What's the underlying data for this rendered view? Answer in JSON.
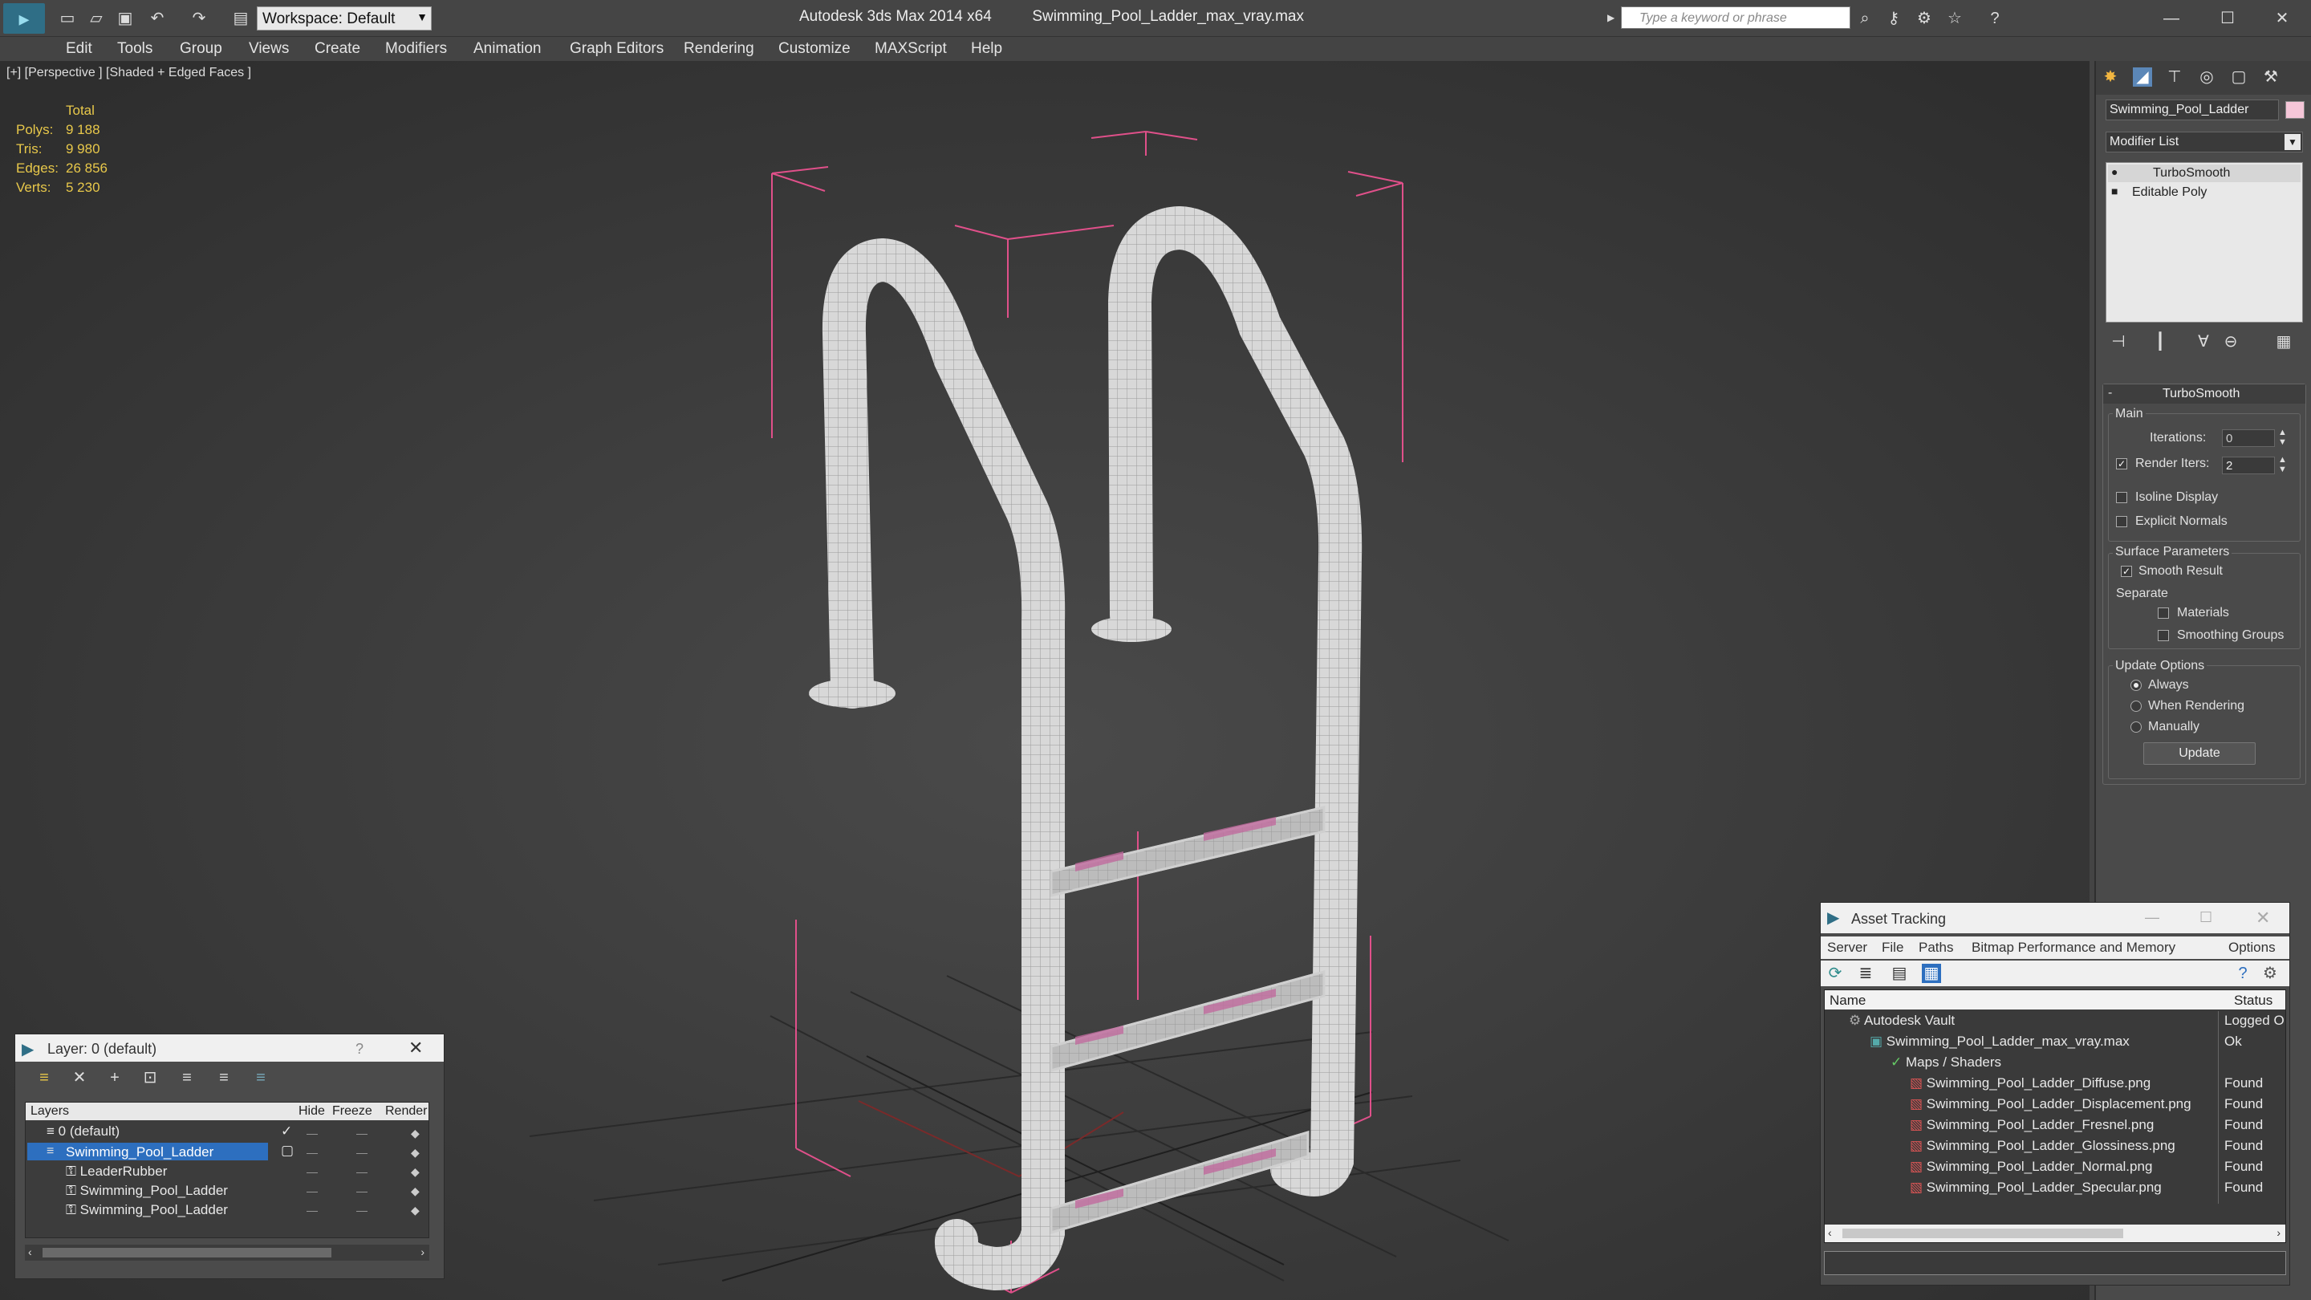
{
  "app": {
    "title": "Autodesk 3ds Max  2014 x64",
    "filename": "Swimming_Pool_Ladder_max_vray.max",
    "workspace": "Workspace: Default",
    "search_placeholder": "Type a keyword or phrase"
  },
  "menu": [
    "Edit",
    "Tools",
    "Group",
    "Views",
    "Create",
    "Modifiers",
    "Animation",
    "Graph Editors",
    "Rendering",
    "Customize",
    "MAXScript",
    "Help"
  ],
  "viewport": {
    "label": "[+] [Perspective ] [Shaded + Edged Faces ]",
    "stats": {
      "header": "Total",
      "rows": [
        {
          "label": "Polys:",
          "value": "9 188"
        },
        {
          "label": "Tris:",
          "value": "9 980"
        },
        {
          "label": "Edges:",
          "value": "26 856"
        },
        {
          "label": "Verts:",
          "value": "5 230"
        }
      ]
    }
  },
  "command_panel": {
    "object_name": "Swimming_Pool_Ladder",
    "modifier_list": "Modifier List",
    "stack": [
      "TurboSmooth",
      "Editable Poly"
    ],
    "rollout_title": "TurboSmooth",
    "main_label": "Main",
    "iterations_label": "Iterations:",
    "iterations_value": "0",
    "render_iters_label": "Render Iters:",
    "render_iters_value": "2",
    "isoline_label": "Isoline Display",
    "explicit_normals_label": "Explicit Normals",
    "surface_params_label": "Surface Parameters",
    "smooth_result_label": "Smooth Result",
    "separate_label": "Separate",
    "materials_label": "Materials",
    "smoothing_groups_label": "Smoothing Groups",
    "update_options_label": "Update Options",
    "always_label": "Always",
    "when_rendering_label": "When Rendering",
    "manually_label": "Manually",
    "update_button": "Update",
    "object_color": "#f5c6d8"
  },
  "layer_window": {
    "title": "Layer: 0 (default)",
    "help": "?",
    "columns": [
      "Layers",
      "Hide",
      "Freeze",
      "Render"
    ],
    "rows": [
      {
        "name": "0 (default)",
        "indent": 0
      },
      {
        "name": "Swimming_Pool_Ladder",
        "indent": 0
      },
      {
        "name": "LeaderRubber",
        "indent": 1
      },
      {
        "name": "Swimming_Pool_Ladder",
        "indent": 1
      },
      {
        "name": "Swimming_Pool_Ladder",
        "indent": 1
      }
    ]
  },
  "asset_window": {
    "title": "Asset Tracking",
    "menu": [
      "Server",
      "File",
      "Paths",
      "Bitmap Performance and Memory",
      "Options"
    ],
    "columns": [
      "Name",
      "Status"
    ],
    "rows": [
      {
        "name": "Autodesk Vault",
        "status": "Logged O",
        "level": 0
      },
      {
        "name": "Swimming_Pool_Ladder_max_vray.max",
        "status": "Ok",
        "level": 1
      },
      {
        "name": "Maps / Shaders",
        "status": "",
        "level": 2
      },
      {
        "name": "Swimming_Pool_Ladder_Diffuse.png",
        "status": "Found",
        "level": 3
      },
      {
        "name": "Swimming_Pool_Ladder_Displacement.png",
        "status": "Found",
        "level": 3
      },
      {
        "name": "Swimming_Pool_Ladder_Fresnel.png",
        "status": "Found",
        "level": 3
      },
      {
        "name": "Swimming_Pool_Ladder_Glossiness.png",
        "status": "Found",
        "level": 3
      },
      {
        "name": "Swimming_Pool_Ladder_Normal.png",
        "status": "Found",
        "level": 3
      },
      {
        "name": "Swimming_Pool_Ladder_Specular.png",
        "status": "Found",
        "level": 3
      }
    ]
  }
}
